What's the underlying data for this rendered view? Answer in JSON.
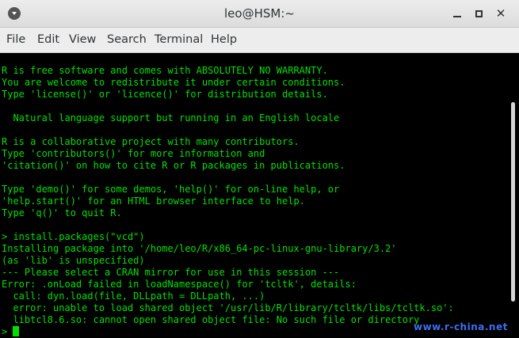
{
  "window": {
    "title": "leo@HSM:~",
    "controls": {
      "minimize": "minimize",
      "maximize": "maximize",
      "close": "✕"
    }
  },
  "menu": [
    {
      "label": "File"
    },
    {
      "label": "Edit"
    },
    {
      "label": "View"
    },
    {
      "label": "Search"
    },
    {
      "label": "Terminal"
    },
    {
      "label": "Help"
    }
  ],
  "terminal": {
    "lines": [
      "R is free software and comes with ABSOLUTELY NO WARRANTY.",
      "You are welcome to redistribute it under certain conditions.",
      "Type 'license()' or 'licence()' for distribution details.",
      "",
      "  Natural language support but running in an English locale",
      "",
      "R is a collaborative project with many contributors.",
      "Type 'contributors()' for more information and",
      "'citation()' on how to cite R or R packages in publications.",
      "",
      "Type 'demo()' for some demos, 'help()' for on-line help, or",
      "'help.start()' for an HTML browser interface to help.",
      "Type 'q()' to quit R.",
      "",
      "> install.packages(\"vcd\")",
      "Installing package into '/home/leo/R/x86_64-pc-linux-gnu-library/3.2'",
      "(as 'lib' is unspecified)",
      "--- Please select a CRAN mirror for use in this session ---",
      "Error: .onLoad failed in loadNamespace() for 'tcltk', details:",
      "  call: dyn.load(file, DLLpath = DLLpath, ...)",
      "  error: unable to load shared object '/usr/lib/R/library/tcltk/libs/tcltk.so':",
      "  libtcl8.6.so: cannot open shared object file: No such file or directory",
      ">"
    ],
    "prompt": ">",
    "text_color": "#00e000",
    "background": "#000000"
  },
  "watermark": "www.r-china.net"
}
